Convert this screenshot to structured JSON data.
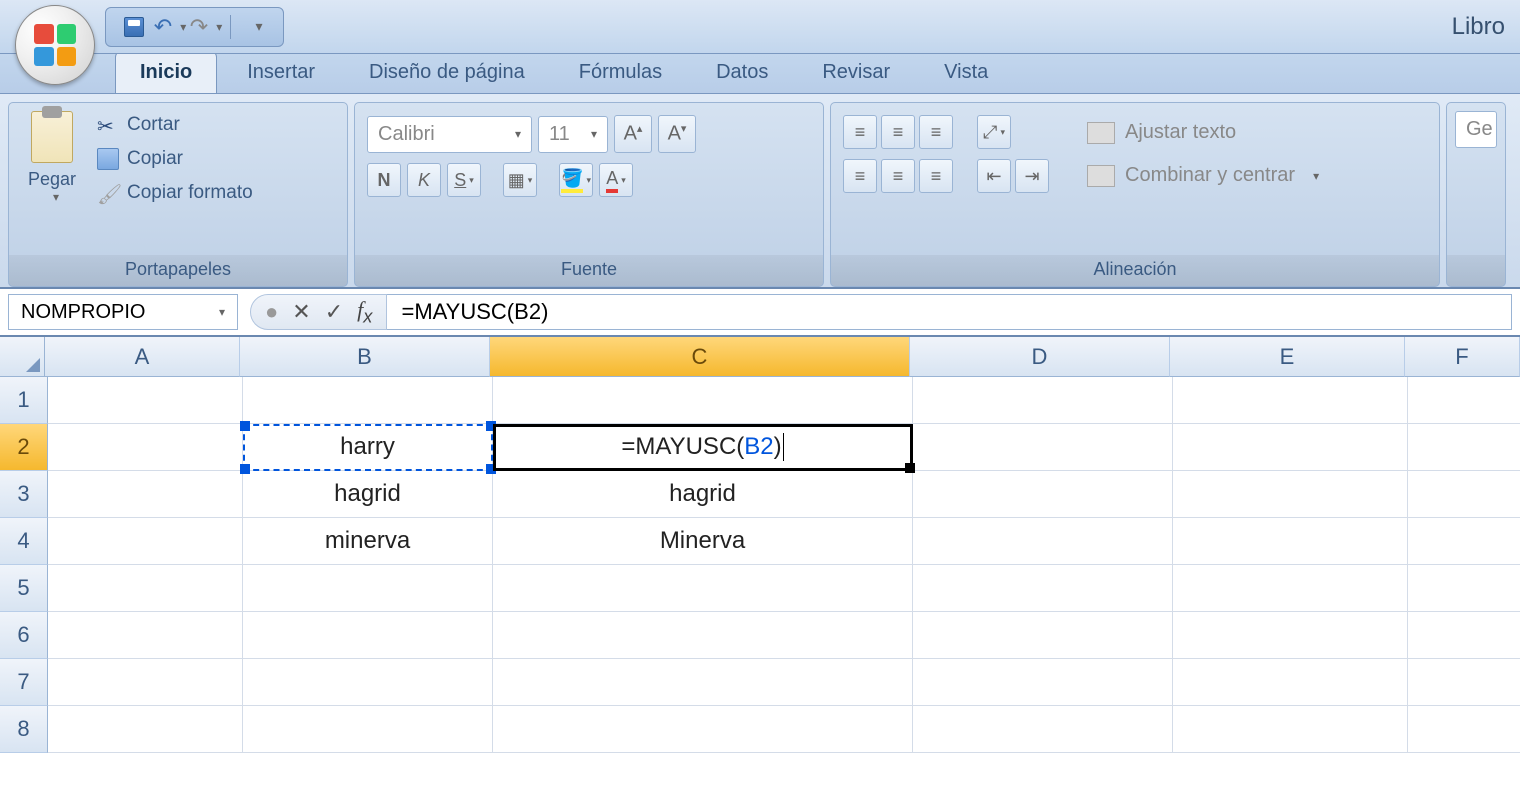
{
  "app": {
    "title": "Libro"
  },
  "qat": {
    "save": "save",
    "undo": "undo",
    "redo": "redo"
  },
  "tabs": [
    "Inicio",
    "Insertar",
    "Diseño de página",
    "Fórmulas",
    "Datos",
    "Revisar",
    "Vista"
  ],
  "active_tab": 0,
  "ribbon": {
    "clipboard": {
      "title": "Portapapeles",
      "paste": "Pegar",
      "cut": "Cortar",
      "copy": "Copiar",
      "format_painter": "Copiar formato"
    },
    "font": {
      "title": "Fuente",
      "name": "Calibri",
      "size": "11",
      "bold": "N",
      "italic": "K",
      "underline": "S"
    },
    "alignment": {
      "title": "Alineación",
      "wrap": "Ajustar texto",
      "merge": "Combinar y centrar"
    },
    "number": {
      "hint": "Ge"
    }
  },
  "formula_bar": {
    "name_box": "NOMPROPIO",
    "formula_prefix": "=MAYUSC(",
    "formula_ref": "B2",
    "formula_suffix": ")"
  },
  "columns": [
    "A",
    "B",
    "C",
    "D",
    "E",
    "F"
  ],
  "rows": [
    "1",
    "2",
    "3",
    "4",
    "5",
    "6",
    "7",
    "8"
  ],
  "active_col": "C",
  "active_row": "2",
  "cells": {
    "B2": "harry",
    "B3": "hagrid",
    "B4": "minerva",
    "C2_prefix": "=MAYUSC(",
    "C2_ref": "B2",
    "C2_suffix": ")",
    "C3": "hagrid",
    "C4": "Minerva"
  },
  "col_widths": {
    "A": 195,
    "B": 250,
    "C": 420,
    "D": 260,
    "E": 235,
    "F": 115
  }
}
